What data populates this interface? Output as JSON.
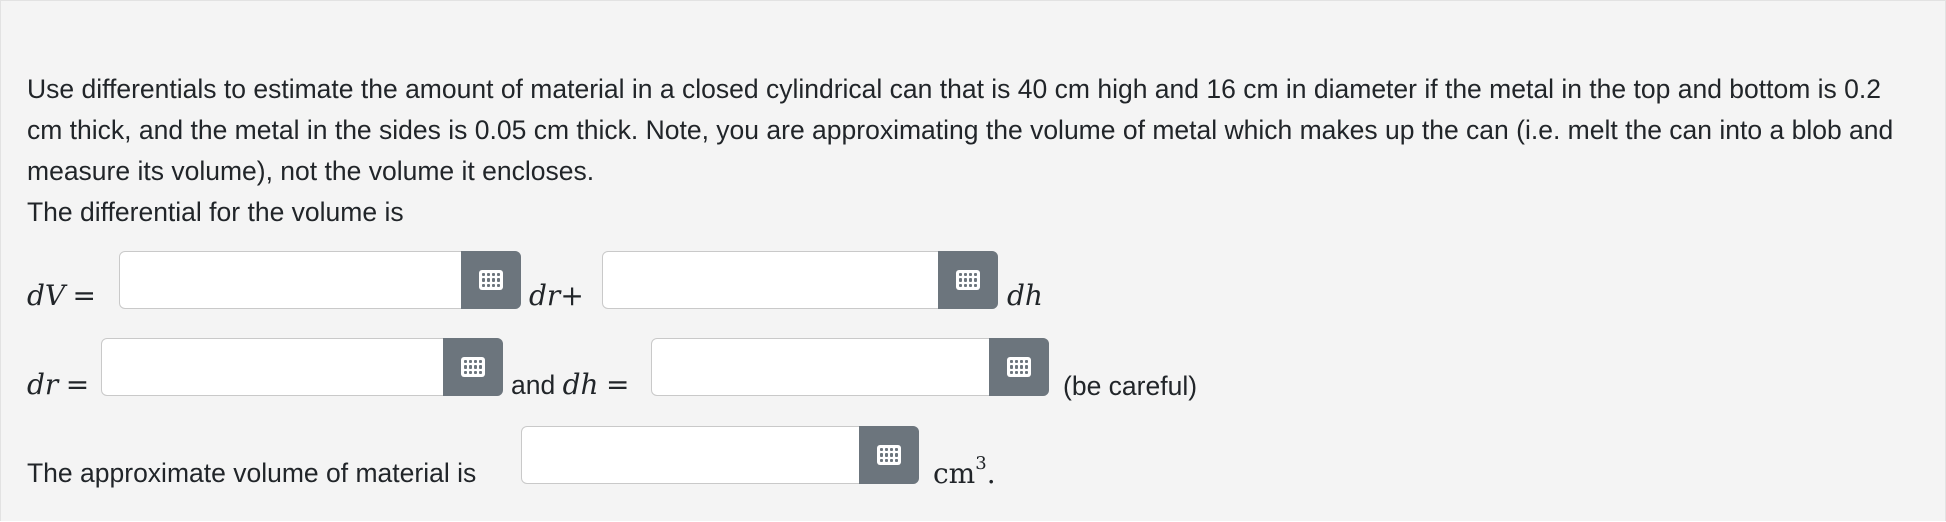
{
  "problem": {
    "statement": "Use differentials to estimate the amount of material in a closed cylindrical can that is 40 cm high and 16 cm in diameter if the metal in the top and bottom is 0.2 cm thick, and the metal in the sides is 0.05 cm thick. Note, you are approximating the volume of metal which makes up the can (i.e. melt the can into a blob and measure its volume), not the volume it encloses.",
    "differential_prompt": "The differential for the volume is"
  },
  "row1": {
    "lhs_var": "dV",
    "eq": "=",
    "mid_var": "dr",
    "plus": "+",
    "end_var": "dh",
    "answer1_value": "",
    "answer2_value": ""
  },
  "row2": {
    "lhs_var": "dr",
    "eq": "=",
    "and_text": "and",
    "mid_var": "dh",
    "mid_eq": "=",
    "note": "(be careful)",
    "answer1_value": "",
    "answer2_value": ""
  },
  "row3": {
    "prompt": "The approximate volume of material is",
    "unit_base": "cm",
    "unit_exp": "3",
    "unit_end": ".",
    "answer_value": ""
  },
  "icons": {
    "math_keyboard": "grid-keyboard-icon"
  }
}
